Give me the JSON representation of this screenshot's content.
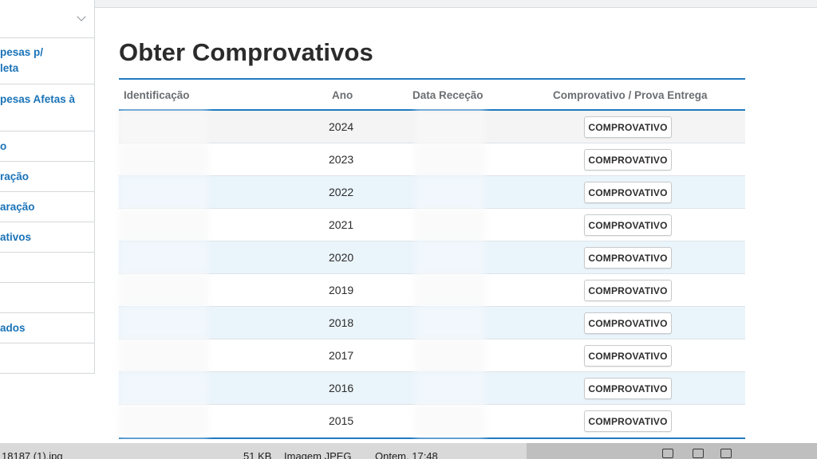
{
  "sidebar": {
    "items": [
      {
        "line1": "pesas p/",
        "line2": "leta"
      },
      {
        "line1": "pesas Afetas à",
        "line2": ""
      },
      {
        "line1": "o",
        "line2": ""
      },
      {
        "line1": "ração",
        "line2": ""
      },
      {
        "line1": "aração",
        "line2": ""
      },
      {
        "line1": "ativos",
        "line2": ""
      },
      {
        "line1": "",
        "line2": ""
      },
      {
        "line1": "",
        "line2": ""
      },
      {
        "line1": "ados",
        "line2": ""
      },
      {
        "line1": "",
        "line2": ""
      }
    ]
  },
  "main": {
    "title": "Obter Comprovativos",
    "table": {
      "headers": [
        "Identificação",
        "Ano",
        "Data Receção",
        "Comprovativo / Prova Entrega"
      ],
      "button_label": "COMPROVATIVO",
      "rows": [
        {
          "ano": "2024"
        },
        {
          "ano": "2023"
        },
        {
          "ano": "2022"
        },
        {
          "ano": "2021"
        },
        {
          "ano": "2020"
        },
        {
          "ano": "2019"
        },
        {
          "ano": "2018"
        },
        {
          "ano": "2017"
        },
        {
          "ano": "2016"
        },
        {
          "ano": "2015"
        }
      ]
    }
  },
  "file_strip": {
    "row_name": "18187 (1).jpg",
    "row_size": "51 KB",
    "row_kind": "Imagem JPEG",
    "row_date": "Ontem, 17:48"
  },
  "colors": {
    "accent": "#1f7ac0",
    "link": "#1a73b8",
    "alt_row": "#eaf4fb"
  }
}
